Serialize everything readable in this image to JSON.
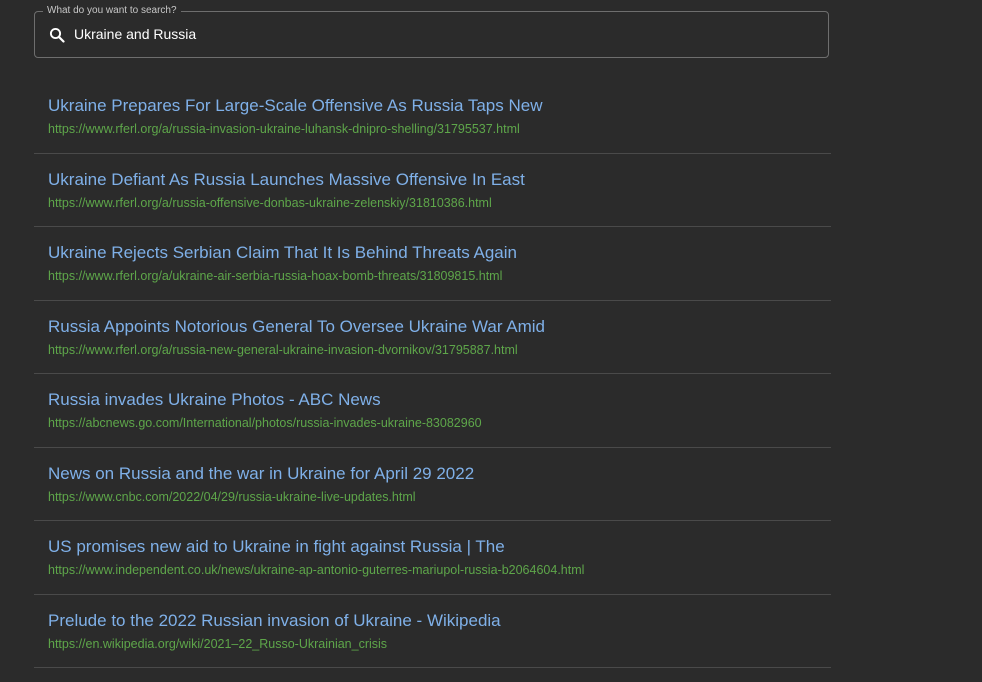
{
  "search": {
    "label": "What do you want to search?",
    "value": "Ukraine and Russia",
    "icon": "search-icon"
  },
  "colors": {
    "background": "#2b2b2b",
    "title": "#7fb0e8",
    "url": "#5ea64a",
    "divider": "#4a4a4a"
  },
  "results": [
    {
      "title": "Ukraine Prepares For Large-Scale Offensive As Russia Taps New",
      "url": "https://www.rferl.org/a/russia-invasion-ukraine-luhansk-dnipro-shelling/31795537.html"
    },
    {
      "title": "Ukraine Defiant As Russia Launches Massive Offensive In East",
      "url": "https://www.rferl.org/a/russia-offensive-donbas-ukraine-zelenskiy/31810386.html"
    },
    {
      "title": "Ukraine Rejects Serbian Claim That It Is Behind Threats Again",
      "url": "https://www.rferl.org/a/ukraine-air-serbia-russia-hoax-bomb-threats/31809815.html"
    },
    {
      "title": "Russia Appoints Notorious General To Oversee Ukraine War Amid",
      "url": "https://www.rferl.org/a/russia-new-general-ukraine-invasion-dvornikov/31795887.html"
    },
    {
      "title": "Russia invades Ukraine Photos - ABC News",
      "url": "https://abcnews.go.com/International/photos/russia-invades-ukraine-83082960"
    },
    {
      "title": "News on Russia and the war in Ukraine for April 29 2022",
      "url": "https://www.cnbc.com/2022/04/29/russia-ukraine-live-updates.html"
    },
    {
      "title": "US promises new aid to Ukraine in fight against Russia | The",
      "url": "https://www.independent.co.uk/news/ukraine-ap-antonio-guterres-mariupol-russia-b2064604.html"
    },
    {
      "title": "Prelude to the 2022 Russian invasion of Ukraine - Wikipedia",
      "url": "https://en.wikipedia.org/wiki/2021–22_Russo-Ukrainian_crisis"
    }
  ]
}
